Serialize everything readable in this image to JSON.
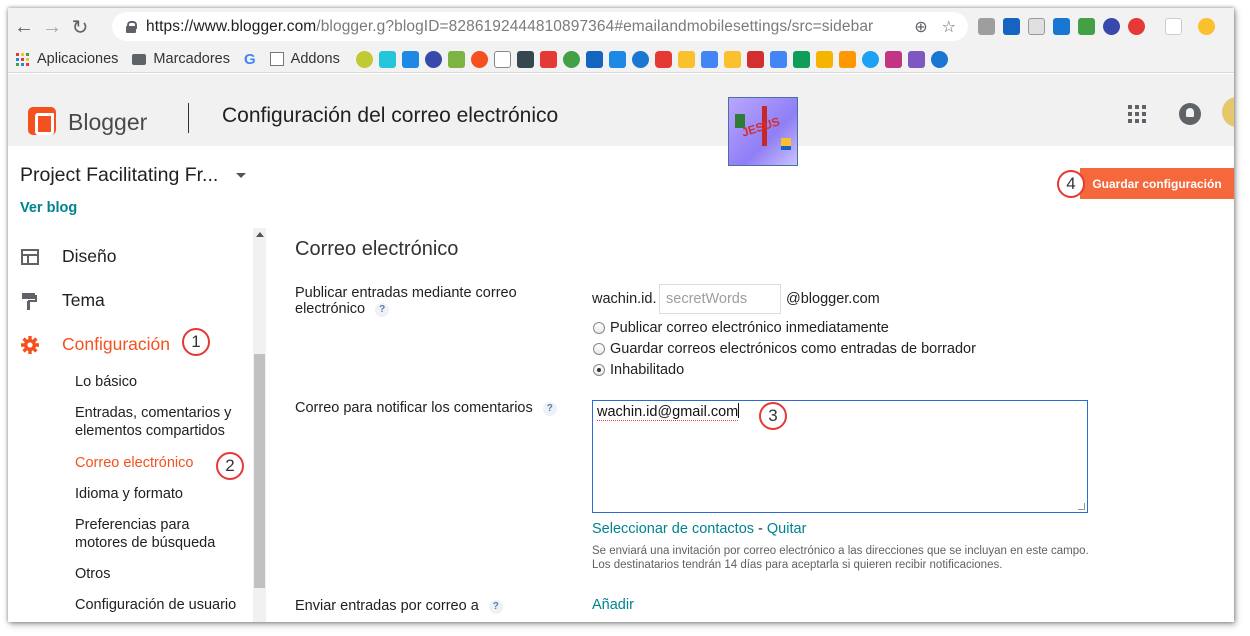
{
  "browser": {
    "url_host": "https://www.blogger.com",
    "url_rest": "/blogger.g?blogID=8286192444810897364#emailandmobilesettings/src=sidebar"
  },
  "bookmarks": {
    "apps": "Aplicaciones",
    "marcadores": "Marcadores",
    "addons": "Addons"
  },
  "header": {
    "brand": "Blogger",
    "title": "Configuración del correo electrónico",
    "avatar_text": "JESÚS"
  },
  "blog": {
    "name": "Project Facilitating Fr...",
    "view_link": "Ver blog"
  },
  "save_button": "Guardar configuración",
  "sidebar": {
    "items": [
      {
        "label": "Diseño",
        "icon": "layout-icon"
      },
      {
        "label": "Tema",
        "icon": "paint-roller-icon"
      },
      {
        "label": "Configuración",
        "icon": "gear-icon"
      }
    ],
    "sub_items": [
      "Lo básico",
      "Entradas, comentarios y elementos compartidos",
      "Correo electrónico",
      "Idioma y formato",
      "Preferencias para motores de búsqueda",
      "Otros",
      "Configuración de usuario"
    ]
  },
  "badges": [
    "1",
    "2",
    "3",
    "4"
  ],
  "content": {
    "section_title": "Correo electrónico",
    "publish_label": "Publicar entradas mediante correo electrónico",
    "help": "?",
    "email_prefix": "wachin.id.",
    "secret_placeholder": "secretWords",
    "email_suffix": "@blogger.com",
    "radio_options": [
      "Publicar correo electrónico inmediatamente",
      "Guardar correos electrónicos como entradas de borrador",
      "Inhabilitado"
    ],
    "notify_label": "Correo para notificar los comentarios",
    "notify_value": "wachin.id@gmail.com",
    "select_contacts": "Seleccionar de contactos",
    "remove": "Quitar",
    "note": "Se enviará una invitación por correo electrónico a las direcciones que se incluyan en este campo. Los destinatarios tendrán 14 días para aceptarla si quieren recibir notificaciones.",
    "send_label": "Enviar entradas por correo a",
    "add": "Añadir"
  },
  "colors": {
    "accent": "#f4511e",
    "link": "#00838f",
    "save_button": "#f4683c"
  }
}
